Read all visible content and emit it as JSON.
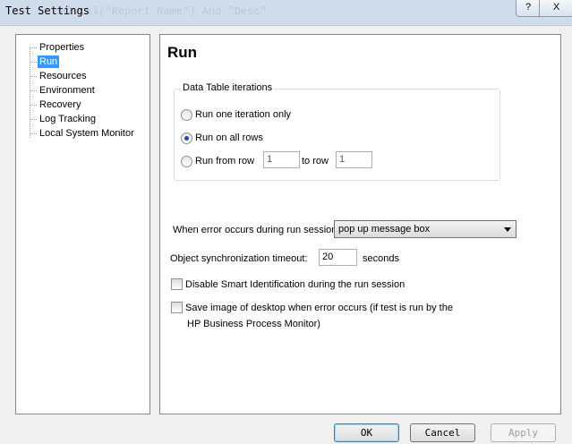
{
  "window": {
    "title": "Test Settings",
    "ghost_text": "calutil(\"Report Name\") And \"Desc\"",
    "help_label": "?",
    "close_label": "X"
  },
  "tree": {
    "items": [
      {
        "label": "Properties",
        "selected": false
      },
      {
        "label": "Run",
        "selected": true
      },
      {
        "label": "Resources",
        "selected": false
      },
      {
        "label": "Environment",
        "selected": false
      },
      {
        "label": "Recovery",
        "selected": false
      },
      {
        "label": "Log Tracking",
        "selected": false
      },
      {
        "label": "Local System Monitor",
        "selected": false
      }
    ]
  },
  "panel": {
    "heading": "Run",
    "data_table": {
      "group_label": "Data Table iterations",
      "options": [
        {
          "label": "Run one iteration only",
          "selected": false
        },
        {
          "label": "Run on all rows",
          "selected": true
        },
        {
          "label": "Run from row",
          "selected": false
        }
      ],
      "from_row_value": "1",
      "to_row_label": "to row",
      "to_row_value": "1"
    },
    "error_label": "When error occurs during run session:",
    "error_value": "pop up message box",
    "timeout_label": "Object synchronization timeout:",
    "timeout_value": "20",
    "timeout_unit": "seconds",
    "disable_smart_label": "Disable Smart Identification during the run session",
    "disable_smart_checked": false,
    "save_image_label_1": "Save image of desktop when error occurs (if test is run by the",
    "save_image_label_2": "HP Business Process Monitor)",
    "save_image_checked": false
  },
  "buttons": {
    "ok": "OK",
    "cancel": "Cancel",
    "apply": "Apply"
  }
}
